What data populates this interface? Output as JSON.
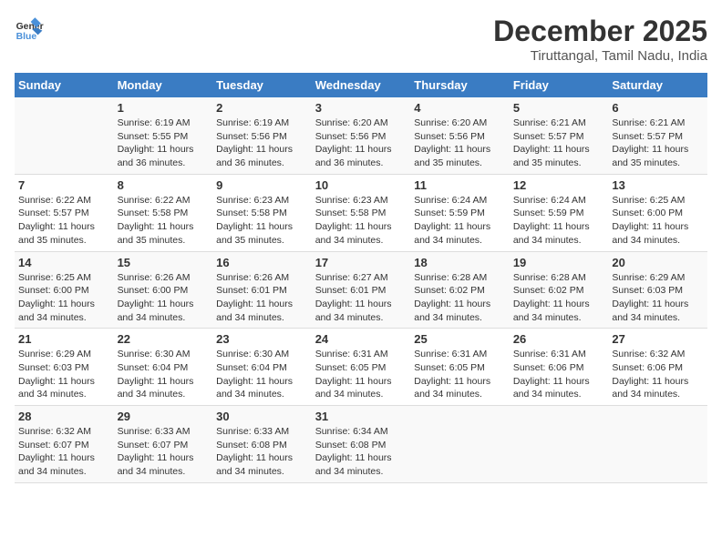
{
  "logo": {
    "general": "General",
    "blue": "Blue"
  },
  "header": {
    "title": "December 2025",
    "subtitle": "Tiruttangal, Tamil Nadu, India"
  },
  "days_of_week": [
    "Sunday",
    "Monday",
    "Tuesday",
    "Wednesday",
    "Thursday",
    "Friday",
    "Saturday"
  ],
  "weeks": [
    [
      {
        "num": "",
        "sunrise": "",
        "sunset": "",
        "daylight": ""
      },
      {
        "num": "1",
        "sunrise": "Sunrise: 6:19 AM",
        "sunset": "Sunset: 5:55 PM",
        "daylight": "Daylight: 11 hours and 36 minutes."
      },
      {
        "num": "2",
        "sunrise": "Sunrise: 6:19 AM",
        "sunset": "Sunset: 5:56 PM",
        "daylight": "Daylight: 11 hours and 36 minutes."
      },
      {
        "num": "3",
        "sunrise": "Sunrise: 6:20 AM",
        "sunset": "Sunset: 5:56 PM",
        "daylight": "Daylight: 11 hours and 36 minutes."
      },
      {
        "num": "4",
        "sunrise": "Sunrise: 6:20 AM",
        "sunset": "Sunset: 5:56 PM",
        "daylight": "Daylight: 11 hours and 35 minutes."
      },
      {
        "num": "5",
        "sunrise": "Sunrise: 6:21 AM",
        "sunset": "Sunset: 5:57 PM",
        "daylight": "Daylight: 11 hours and 35 minutes."
      },
      {
        "num": "6",
        "sunrise": "Sunrise: 6:21 AM",
        "sunset": "Sunset: 5:57 PM",
        "daylight": "Daylight: 11 hours and 35 minutes."
      }
    ],
    [
      {
        "num": "7",
        "sunrise": "Sunrise: 6:22 AM",
        "sunset": "Sunset: 5:57 PM",
        "daylight": "Daylight: 11 hours and 35 minutes."
      },
      {
        "num": "8",
        "sunrise": "Sunrise: 6:22 AM",
        "sunset": "Sunset: 5:58 PM",
        "daylight": "Daylight: 11 hours and 35 minutes."
      },
      {
        "num": "9",
        "sunrise": "Sunrise: 6:23 AM",
        "sunset": "Sunset: 5:58 PM",
        "daylight": "Daylight: 11 hours and 35 minutes."
      },
      {
        "num": "10",
        "sunrise": "Sunrise: 6:23 AM",
        "sunset": "Sunset: 5:58 PM",
        "daylight": "Daylight: 11 hours and 34 minutes."
      },
      {
        "num": "11",
        "sunrise": "Sunrise: 6:24 AM",
        "sunset": "Sunset: 5:59 PM",
        "daylight": "Daylight: 11 hours and 34 minutes."
      },
      {
        "num": "12",
        "sunrise": "Sunrise: 6:24 AM",
        "sunset": "Sunset: 5:59 PM",
        "daylight": "Daylight: 11 hours and 34 minutes."
      },
      {
        "num": "13",
        "sunrise": "Sunrise: 6:25 AM",
        "sunset": "Sunset: 6:00 PM",
        "daylight": "Daylight: 11 hours and 34 minutes."
      }
    ],
    [
      {
        "num": "14",
        "sunrise": "Sunrise: 6:25 AM",
        "sunset": "Sunset: 6:00 PM",
        "daylight": "Daylight: 11 hours and 34 minutes."
      },
      {
        "num": "15",
        "sunrise": "Sunrise: 6:26 AM",
        "sunset": "Sunset: 6:00 PM",
        "daylight": "Daylight: 11 hours and 34 minutes."
      },
      {
        "num": "16",
        "sunrise": "Sunrise: 6:26 AM",
        "sunset": "Sunset: 6:01 PM",
        "daylight": "Daylight: 11 hours and 34 minutes."
      },
      {
        "num": "17",
        "sunrise": "Sunrise: 6:27 AM",
        "sunset": "Sunset: 6:01 PM",
        "daylight": "Daylight: 11 hours and 34 minutes."
      },
      {
        "num": "18",
        "sunrise": "Sunrise: 6:28 AM",
        "sunset": "Sunset: 6:02 PM",
        "daylight": "Daylight: 11 hours and 34 minutes."
      },
      {
        "num": "19",
        "sunrise": "Sunrise: 6:28 AM",
        "sunset": "Sunset: 6:02 PM",
        "daylight": "Daylight: 11 hours and 34 minutes."
      },
      {
        "num": "20",
        "sunrise": "Sunrise: 6:29 AM",
        "sunset": "Sunset: 6:03 PM",
        "daylight": "Daylight: 11 hours and 34 minutes."
      }
    ],
    [
      {
        "num": "21",
        "sunrise": "Sunrise: 6:29 AM",
        "sunset": "Sunset: 6:03 PM",
        "daylight": "Daylight: 11 hours and 34 minutes."
      },
      {
        "num": "22",
        "sunrise": "Sunrise: 6:30 AM",
        "sunset": "Sunset: 6:04 PM",
        "daylight": "Daylight: 11 hours and 34 minutes."
      },
      {
        "num": "23",
        "sunrise": "Sunrise: 6:30 AM",
        "sunset": "Sunset: 6:04 PM",
        "daylight": "Daylight: 11 hours and 34 minutes."
      },
      {
        "num": "24",
        "sunrise": "Sunrise: 6:31 AM",
        "sunset": "Sunset: 6:05 PM",
        "daylight": "Daylight: 11 hours and 34 minutes."
      },
      {
        "num": "25",
        "sunrise": "Sunrise: 6:31 AM",
        "sunset": "Sunset: 6:05 PM",
        "daylight": "Daylight: 11 hours and 34 minutes."
      },
      {
        "num": "26",
        "sunrise": "Sunrise: 6:31 AM",
        "sunset": "Sunset: 6:06 PM",
        "daylight": "Daylight: 11 hours and 34 minutes."
      },
      {
        "num": "27",
        "sunrise": "Sunrise: 6:32 AM",
        "sunset": "Sunset: 6:06 PM",
        "daylight": "Daylight: 11 hours and 34 minutes."
      }
    ],
    [
      {
        "num": "28",
        "sunrise": "Sunrise: 6:32 AM",
        "sunset": "Sunset: 6:07 PM",
        "daylight": "Daylight: 11 hours and 34 minutes."
      },
      {
        "num": "29",
        "sunrise": "Sunrise: 6:33 AM",
        "sunset": "Sunset: 6:07 PM",
        "daylight": "Daylight: 11 hours and 34 minutes."
      },
      {
        "num": "30",
        "sunrise": "Sunrise: 6:33 AM",
        "sunset": "Sunset: 6:08 PM",
        "daylight": "Daylight: 11 hours and 34 minutes."
      },
      {
        "num": "31",
        "sunrise": "Sunrise: 6:34 AM",
        "sunset": "Sunset: 6:08 PM",
        "daylight": "Daylight: 11 hours and 34 minutes."
      },
      {
        "num": "",
        "sunrise": "",
        "sunset": "",
        "daylight": ""
      },
      {
        "num": "",
        "sunrise": "",
        "sunset": "",
        "daylight": ""
      },
      {
        "num": "",
        "sunrise": "",
        "sunset": "",
        "daylight": ""
      }
    ]
  ]
}
